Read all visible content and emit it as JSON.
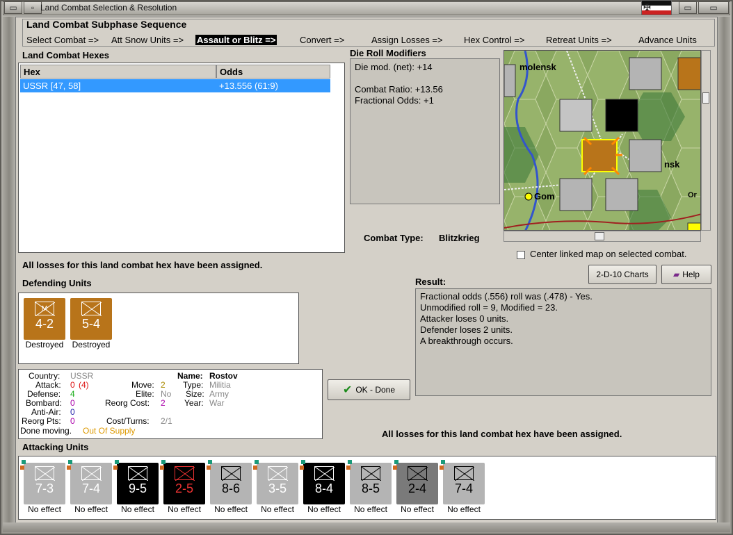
{
  "window": {
    "title": "Land Combat Selection & Resolution"
  },
  "subphase": {
    "title": "Land Combat Subphase Sequence",
    "steps": [
      "Select Combat =>",
      "Att Snow Units =>",
      "Assault or Blitz =>",
      "Convert =>",
      "Assign Losses =>",
      "Hex Control =>",
      "Retreat Units =>",
      "Advance Units"
    ],
    "active_index": 2
  },
  "hexes": {
    "title": "Land Combat Hexes",
    "columns": [
      "Hex",
      "Odds"
    ],
    "rows": [
      {
        "hex": "USSR [47, 58]",
        "odds": "+13.556 (61:9)"
      }
    ]
  },
  "modifiers": {
    "title": "Die Roll Modifiers",
    "line1": "Die mod. (net): +14",
    "line2": "Combat Ratio: +13.56",
    "line3": "Fractional Odds: +1"
  },
  "combat_type": {
    "label": "Combat Type:",
    "value": "Blitzkrieg"
  },
  "map": {
    "labels": [
      "molensk",
      "Gom",
      "nsk",
      "Or"
    ],
    "center_label": "Center linked map on selected combat."
  },
  "losses_msg": "All losses for this land combat hex have been assigned.",
  "buttons": {
    "charts": "2-D-10 Charts",
    "help": "Help",
    "ok": "OK - Done"
  },
  "defending": {
    "title": "Defending Units",
    "units": [
      {
        "value": "4-2",
        "status": "Destroyed",
        "bg": "#b8741a",
        "fg": "#fff",
        "sym": "M"
      },
      {
        "value": "5-4",
        "status": "Destroyed",
        "bg": "#b8741a",
        "fg": "#fff",
        "sym": ""
      }
    ]
  },
  "result": {
    "title": "Result:",
    "lines": [
      "Fractional odds (.556) roll was (.478)  - Yes.",
      "Unmodified roll = 9, Modified = 23.",
      "Attacker loses 0 units.",
      "Defender loses 2 units.",
      "A breakthrough occurs."
    ]
  },
  "unit_info": {
    "country_label": "Country:",
    "country": "USSR",
    "attack_label": "Attack:",
    "attack": "0",
    "attack_mod": "(4)",
    "defense_label": "Defense:",
    "defense": "4",
    "bombard_label": "Bombard:",
    "bombard": "0",
    "antiair_label": "Anti-Air:",
    "antiair": "0",
    "reorg_label": "Reorg Pts:",
    "reorg": "0",
    "move_label": "Move:",
    "move": "2",
    "elite_label": "Elite:",
    "elite": "No",
    "reorgcost_label": "Reorg Cost:",
    "reorgcost": "2",
    "costturns_label": "Cost/Turns:",
    "costturns": "2/1",
    "name_label": "Name:",
    "name": "Rostov",
    "type_label": "Type:",
    "type": "Militia",
    "size_label": "Size:",
    "size": "Army",
    "year_label": "Year:",
    "year": "War",
    "done": "Done moving.",
    "supply": "Out Of Supply"
  },
  "attacking": {
    "title": "Attacking Units",
    "units": [
      {
        "value": "7-3",
        "status": "No effect",
        "bg": "#b4b4b4",
        "fg": "#fff"
      },
      {
        "value": "7-4",
        "status": "No effect",
        "bg": "#b4b4b4",
        "fg": "#fff"
      },
      {
        "value": "9-5",
        "status": "No effect",
        "bg": "#000000",
        "fg": "#fff"
      },
      {
        "value": "2-5",
        "status": "No effect",
        "bg": "#000000",
        "fg": "#e33"
      },
      {
        "value": "8-6",
        "status": "No effect",
        "bg": "#b4b4b4",
        "fg": "#000"
      },
      {
        "value": "3-5",
        "status": "No effect",
        "bg": "#b4b4b4",
        "fg": "#fff"
      },
      {
        "value": "8-4",
        "status": "No effect",
        "bg": "#000000",
        "fg": "#fff"
      },
      {
        "value": "8-5",
        "status": "No effect",
        "bg": "#b4b4b4",
        "fg": "#000"
      },
      {
        "value": "2-4",
        "status": "No effect",
        "bg": "#7a7a7a",
        "fg": "#000"
      },
      {
        "value": "7-4",
        "status": "No effect",
        "bg": "#b4b4b4",
        "fg": "#000"
      }
    ]
  }
}
